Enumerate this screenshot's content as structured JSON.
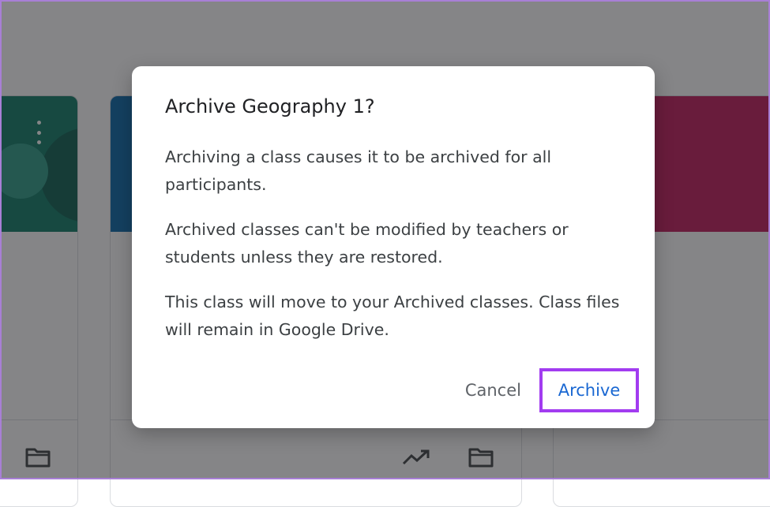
{
  "dialog": {
    "title": "Archive Geography 1?",
    "paragraphs": [
      "Archiving a class causes it to be archived for all participants.",
      "Archived classes can't be modified by teachers or students unless they are restored.",
      "This class will move to your Archived classes. Class files will remain in Google Drive."
    ],
    "cancel_label": "Cancel",
    "archive_label": "Archive"
  },
  "colors": {
    "accent": "#1967d2",
    "highlight": "#a23cf0",
    "card_green": "#0c7a64",
    "card_blue": "#0667a8",
    "card_pink": "#c0185a"
  },
  "icons": {
    "folder": "folder-icon",
    "trending": "trending-up-icon",
    "more": "more-vert-icon"
  }
}
